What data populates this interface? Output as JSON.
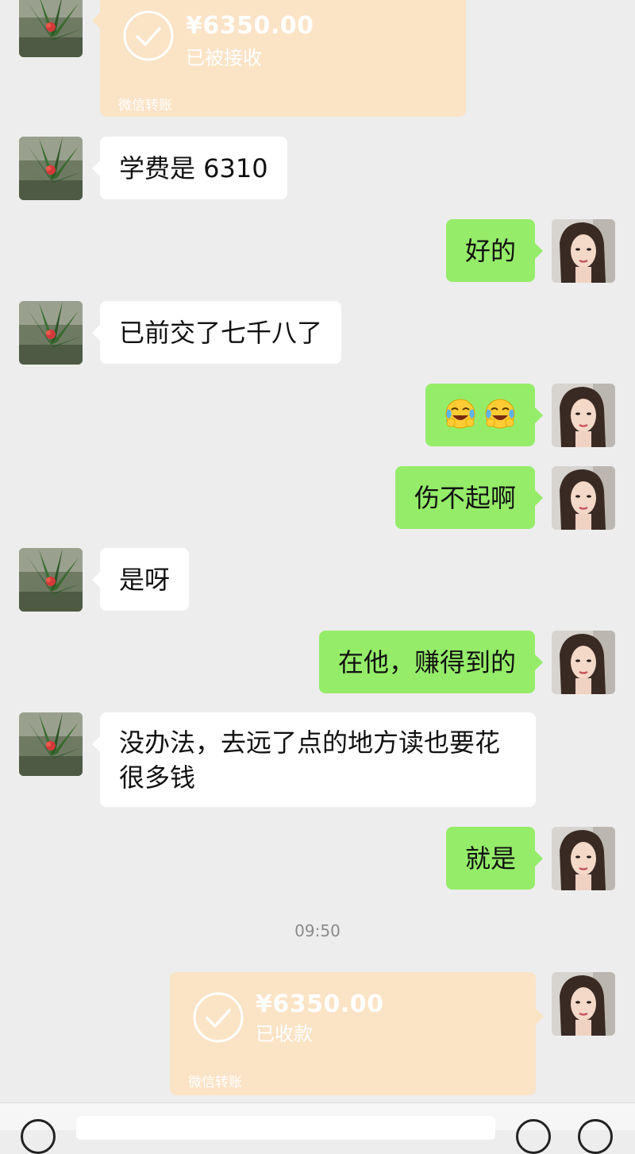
{
  "messages": [
    {
      "type": "transfer",
      "side": "in",
      "amount": "¥6350.00",
      "status": "已被接收",
      "label": "微信转账"
    },
    {
      "type": "text",
      "side": "in",
      "text": "学费是 6310"
    },
    {
      "type": "text",
      "side": "out",
      "text": "好的"
    },
    {
      "type": "text",
      "side": "in",
      "text": "已前交了七千八了"
    },
    {
      "type": "emoji",
      "side": "out",
      "emoji": "crying-laughing-face",
      "count": 2
    },
    {
      "type": "text",
      "side": "out",
      "text": "伤不起啊"
    },
    {
      "type": "text",
      "side": "in",
      "text": "是呀"
    },
    {
      "type": "text",
      "side": "out",
      "text": "在他，赚得到的"
    },
    {
      "type": "text",
      "side": "in",
      "text": "没办法，去远了点的地方读也要花很多钱"
    },
    {
      "type": "text",
      "side": "out",
      "text": "就是"
    },
    {
      "type": "time",
      "text": "09:50"
    },
    {
      "type": "transfer",
      "side": "out",
      "amount": "¥6350.00",
      "status": "已收款",
      "label": "微信转账"
    }
  ],
  "colors": {
    "background": "#ededed",
    "incoming_bubble": "#ffffff",
    "outgoing_bubble": "#95ec69",
    "transfer_card": "#fbe3c6"
  }
}
